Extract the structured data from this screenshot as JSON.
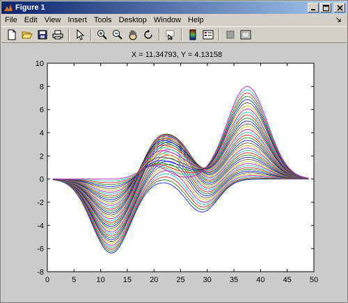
{
  "window": {
    "title": "Figure 1"
  },
  "menu": {
    "items": [
      "File",
      "Edit",
      "View",
      "Insert",
      "Tools",
      "Desktop",
      "Window",
      "Help"
    ]
  },
  "toolbar": {
    "icons": [
      "new-figure-icon",
      "open-file-icon",
      "save-icon",
      "print-icon",
      "edit-plot-icon",
      "zoom-in-icon",
      "zoom-out-icon",
      "pan-icon",
      "rotate-3d-icon",
      "data-cursor-icon",
      "colorbar-icon",
      "legend-icon",
      "hide-plot-tools-icon",
      "show-plot-tools-icon"
    ]
  },
  "figure": {
    "coordinate_readout": "X = 11.34793, Y = 4.13158"
  },
  "chart_data": {
    "type": "line",
    "title": "",
    "xlabel": "",
    "ylabel": "",
    "xlim": [
      0,
      50
    ],
    "ylim": [
      -8,
      10
    ],
    "xticks": [
      0,
      5,
      10,
      15,
      20,
      25,
      30,
      35,
      40,
      45,
      50
    ],
    "yticks": [
      -8,
      -6,
      -4,
      -2,
      0,
      2,
      4,
      6,
      8,
      10
    ],
    "grid": false,
    "legend": "none",
    "series_count": 40,
    "x_range": [
      1,
      49
    ],
    "colors": [
      "#0000ff",
      "#008000",
      "#ff0000",
      "#00bfbf",
      "#bf00bf",
      "#bfbf00",
      "#404040"
    ],
    "features": {
      "trough_1": {
        "x": 12,
        "min_y": -6.4
      },
      "peak_1": {
        "x": 20,
        "max_y": 3.8
      },
      "trough_2": {
        "x": 29,
        "min_y": -3.0
      },
      "peak_2": {
        "x": 25,
        "max_y": 3.6
      },
      "peak_3": {
        "x": 37.5,
        "max_y": 8.0
      }
    }
  }
}
